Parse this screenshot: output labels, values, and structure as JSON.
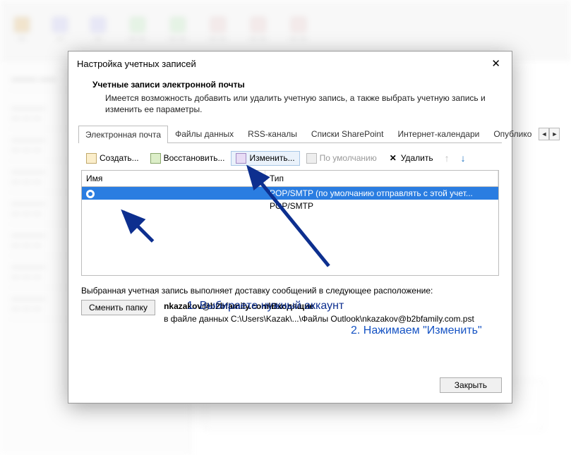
{
  "dialog": {
    "title": "Настройка учетных записей",
    "header_title": "Учетные записи электронной почты",
    "header_text": "Имеется возможность добавить или удалить учетную запись, а также выбрать учетную запись и изменить ее параметры.",
    "tabs": [
      "Электронная почта",
      "Файлы данных",
      "RSS-каналы",
      "Списки SharePoint",
      "Интернет-календари",
      "Опублико"
    ],
    "toolbar": {
      "create": "Создать...",
      "restore": "Восстановить...",
      "edit": "Изменить...",
      "default": "По умолчанию",
      "delete": "Удалить"
    },
    "columns": {
      "name": "Имя",
      "type": "Тип"
    },
    "rows": [
      {
        "name": "",
        "type": "POP/SMTP (по умолчанию отправлять с этой учет...",
        "selected": true,
        "default": true
      },
      {
        "name": "",
        "type": "POP/SMTP",
        "selected": false,
        "default": false
      }
    ],
    "delivery_label": "Выбранная учетная запись выполняет доставку сообщений в следующее расположение:",
    "change_folder_btn": "Сменить папку",
    "path_name": "nkazakov@b2bfamily.com\\Входящие",
    "path_detail": "в файле данных C:\\Users\\Kazak\\...\\Файлы Outlook\\nkazakov@b2bfamily.com.pst",
    "close_btn": "Закрыть"
  },
  "annotations": {
    "step1": "1. Выбираете нужный аккаунт",
    "step2": "2. Нажимаем \"Изменить\""
  }
}
